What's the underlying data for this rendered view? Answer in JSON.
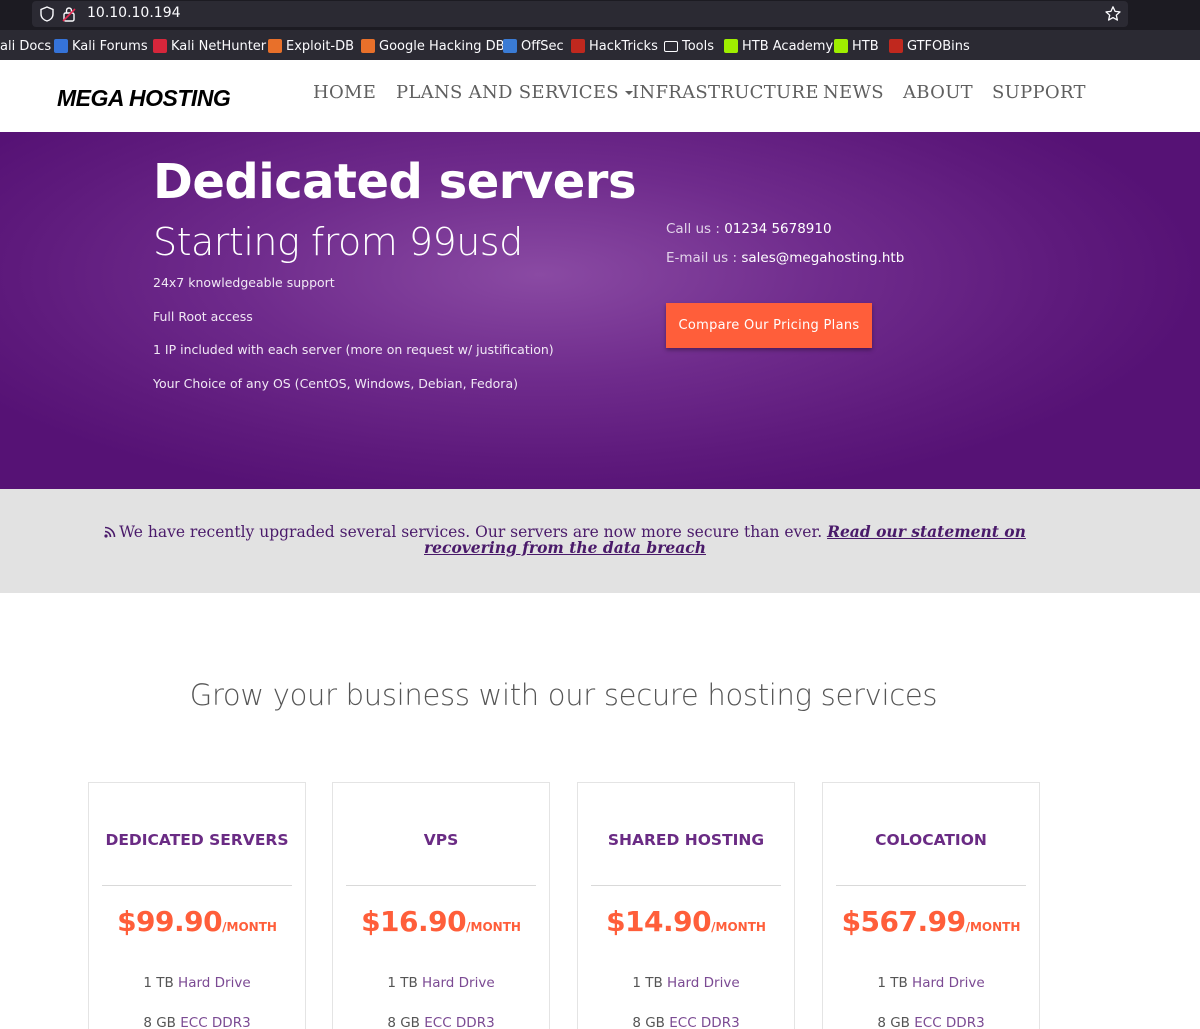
{
  "browser": {
    "url": "10.10.10.194",
    "bookmarks": [
      {
        "label": "ali Docs",
        "icon": "kali-docs-icon",
        "color": "#2b2a33"
      },
      {
        "label": "Kali Forums",
        "icon": "kali-forums-icon",
        "color": "#3573d9"
      },
      {
        "label": "Kali NetHunter",
        "icon": "kali-nethunter-icon",
        "color": "#d6263b"
      },
      {
        "label": "Exploit-DB",
        "icon": "exploit-db-icon",
        "color": "#e8702a"
      },
      {
        "label": "Google Hacking DB",
        "icon": "ghdb-icon",
        "color": "#e8702a"
      },
      {
        "label": "OffSec",
        "icon": "offsec-icon",
        "color": "#3a7bd5"
      },
      {
        "label": "HackTricks",
        "icon": "hacktricks-icon",
        "color": "#c0281e"
      },
      {
        "label": "Tools",
        "icon": "folder-icon",
        "color": "#fbfbfe"
      },
      {
        "label": "HTB Academy",
        "icon": "htb-academy-icon",
        "color": "#9fef00"
      },
      {
        "label": "HTB",
        "icon": "htb-icon",
        "color": "#9fef00"
      },
      {
        "label": "GTFOBins",
        "icon": "gtfobins-icon",
        "color": "#c0281e"
      }
    ]
  },
  "header": {
    "logo": "MEGA HOSTING",
    "nav": [
      "HOME",
      "PLANS AND SERVICES",
      "INFRASTRUCTURE",
      "NEWS",
      "ABOUT",
      "SUPPORT"
    ]
  },
  "hero": {
    "title": "Dedicated servers",
    "subtitle": "Starting from 99usd",
    "features": [
      "24x7 knowledgeable support",
      "Full Root access",
      "1 IP included with each server (more on request w/ justification)",
      "Your Choice of any OS (CentOS, Windows, Debian, Fedora)"
    ],
    "call_label": "Call us :",
    "call_value": "01234 5678910",
    "email_label": "E-mail us :",
    "email_value": "sales@megahosting.htb",
    "cta": "Compare Our Pricing Plans"
  },
  "notice": {
    "text": "We have recently upgraded several services. Our servers are now more secure than ever.",
    "link": "Read our statement on recovering from the data breach"
  },
  "section": {
    "title": "Grow your business with our secure hosting services"
  },
  "plans": [
    {
      "name": "DEDICATED SERVERS",
      "price": "$99.90",
      "per": "/MONTH",
      "specs": [
        {
          "qty": "1 TB",
          "item": "Hard Drive"
        },
        {
          "qty": "8 GB",
          "item": "ECC DDR3"
        }
      ]
    },
    {
      "name": "VPS",
      "price": "$16.90",
      "per": "/MONTH",
      "specs": [
        {
          "qty": "1 TB",
          "item": "Hard Drive"
        },
        {
          "qty": "8 GB",
          "item": "ECC DDR3"
        }
      ]
    },
    {
      "name": "SHARED HOSTING",
      "price": "$14.90",
      "per": "/MONTH",
      "specs": [
        {
          "qty": "1 TB",
          "item": "Hard Drive"
        },
        {
          "qty": "8 GB",
          "item": "ECC DDR3"
        }
      ]
    },
    {
      "name": "COLOCATION",
      "price": "$567.99",
      "per": "/MONTH",
      "specs": [
        {
          "qty": "1 TB",
          "item": "Hard Drive"
        },
        {
          "qty": "8 GB",
          "item": "ECC DDR3"
        }
      ]
    }
  ],
  "colors": {
    "hero_purple": "#6f2b8c",
    "accent_orange": "#ff5e3a",
    "plan_purple": "#6a2b84"
  }
}
